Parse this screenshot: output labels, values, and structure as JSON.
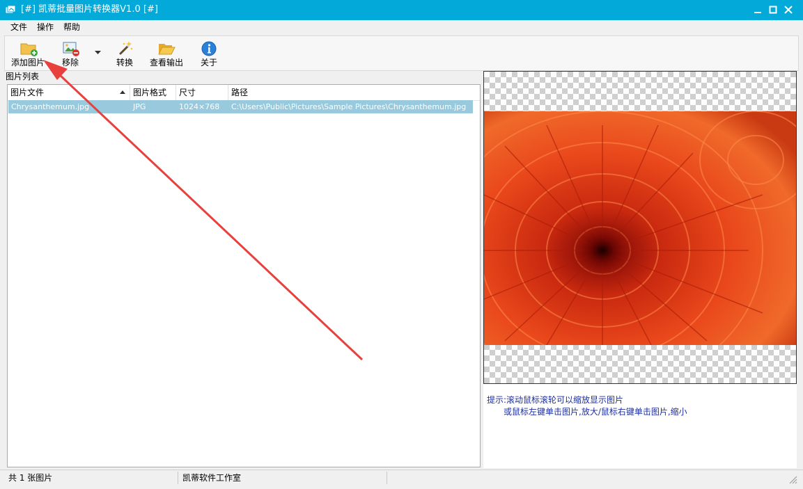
{
  "window": {
    "title": "[#] 凯蒂批量图片转换器V1.0 [#]",
    "title_bar_color": "#03a9d8"
  },
  "menu": {
    "items": [
      "文件",
      "操作",
      "帮助"
    ]
  },
  "toolbar": {
    "add_label": "添加图片",
    "remove_label": "移除",
    "convert_label": "转换",
    "view_output_label": "查看输出",
    "about_label": "关于"
  },
  "file_list": {
    "caption": "图片列表",
    "columns": [
      "图片文件",
      "图片格式",
      "尺寸",
      "路径"
    ],
    "rows": [
      {
        "file": "Chrysanthemum.jpg",
        "format": "JPG",
        "size": "1024×768",
        "path": "C:\\Users\\Public\\Pictures\\Sample Pictures\\Chrysanthemum.jpg"
      }
    ],
    "selected_row_color": "#99c9dc"
  },
  "preview": {
    "hint_line1": "提示:滚动鼠标滚轮可以缩放显示图片",
    "hint_line2": "或鼠标左键单击图片,放大/鼠标右键单击图片,缩小",
    "hint_color": "#1d2fa0"
  },
  "statusbar": {
    "count": "共 1 张图片",
    "studio": "凯蒂软件工作室"
  },
  "annotation": {
    "arrow_color": "#e8403c"
  }
}
